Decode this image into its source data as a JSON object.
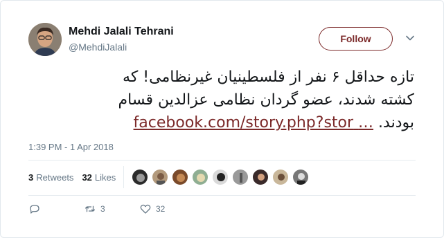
{
  "user": {
    "name": "Mehdi Jalali Tehrani",
    "handle": "@MehdiJalali"
  },
  "follow_label": "Follow",
  "tweet": {
    "line1": "تازه حداقل ۶ نفر از فلسطینیان غیرنظامی! که",
    "line2": "کشته شدند، عضو گردان نظامی عزالدین قسام",
    "line3_text": "بودند.",
    "link": "facebook.com/story.php?stor",
    "ellipsis": "…"
  },
  "timestamp": "1:39 PM - 1 Apr 2018",
  "stats": {
    "retweets_count": "3",
    "retweets_label": "Retweets",
    "likes_count": "32",
    "likes_label": "Likes"
  },
  "likers": [
    "liker-1",
    "liker-2",
    "liker-3",
    "liker-4",
    "liker-5",
    "liker-6",
    "liker-7",
    "liker-8",
    "liker-9"
  ],
  "actions": {
    "reply_count": "",
    "retweet_count": "3",
    "like_count": "32"
  },
  "colors": {
    "accent": "#7b2929",
    "muted": "#657786",
    "text": "#14171a"
  }
}
